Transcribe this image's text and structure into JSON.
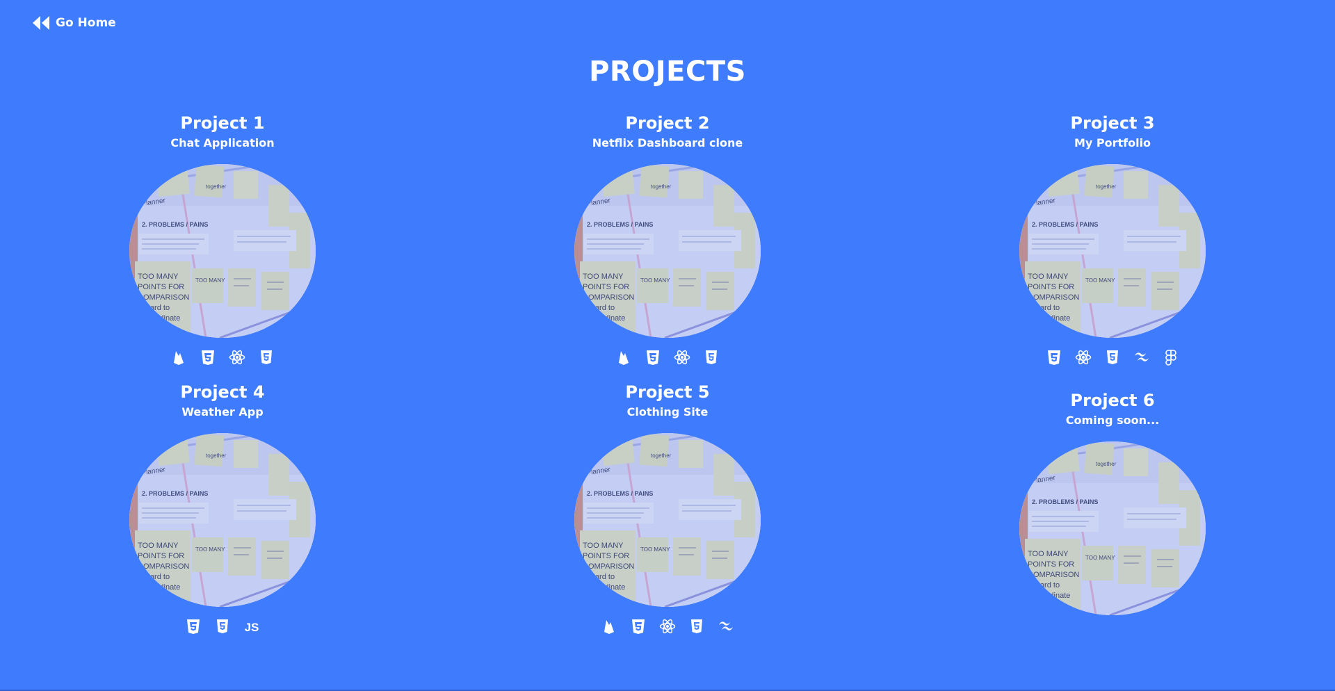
{
  "nav": {
    "home_label": "Go Home",
    "home_icon": "double-chevron-left-icon"
  },
  "page": {
    "title": "PROJECTS",
    "background": "#3f7bfd"
  },
  "projects": [
    {
      "title": "Project 1",
      "subtitle": "Chat Application",
      "thumbnail": "sticky-notes-board-image",
      "tech": [
        "firebase-icon",
        "css3-icon",
        "react-icon",
        "html5-icon"
      ]
    },
    {
      "title": "Project 2",
      "subtitle": "Netflix Dashboard clone",
      "thumbnail": "sticky-notes-board-image",
      "tech": [
        "firebase-icon",
        "css3-icon",
        "react-icon",
        "html5-icon"
      ]
    },
    {
      "title": "Project 3",
      "subtitle": "My Portfolio",
      "thumbnail": "sticky-notes-board-image",
      "tech": [
        "css3-icon",
        "react-icon",
        "html5-icon",
        "tailwind-icon",
        "figma-icon"
      ]
    },
    {
      "title": "Project 4",
      "subtitle": "Weather App",
      "thumbnail": "sticky-notes-board-image",
      "tech": [
        "css3-icon",
        "html5-icon",
        "javascript-icon"
      ]
    },
    {
      "title": "Project 5",
      "subtitle": "Clothing Site",
      "thumbnail": "sticky-notes-board-image",
      "tech": [
        "firebase-icon",
        "css3-icon",
        "react-icon",
        "html5-icon",
        "tailwind-icon"
      ]
    },
    {
      "title": "Project 6",
      "subtitle": "Coming soon...",
      "thumbnail": "sticky-notes-board-image",
      "tech": []
    }
  ],
  "thumbnail_text": {
    "planner": "Planner",
    "problems": "2. PROBLEMS / PAINS",
    "together": "together",
    "too_many": "TOO MANY",
    "points": "POINTS FOR",
    "compare": "COMPARISON",
    "hard": "Hard to",
    "coord": "coordinate"
  },
  "tech_text": {
    "js": "JS"
  }
}
